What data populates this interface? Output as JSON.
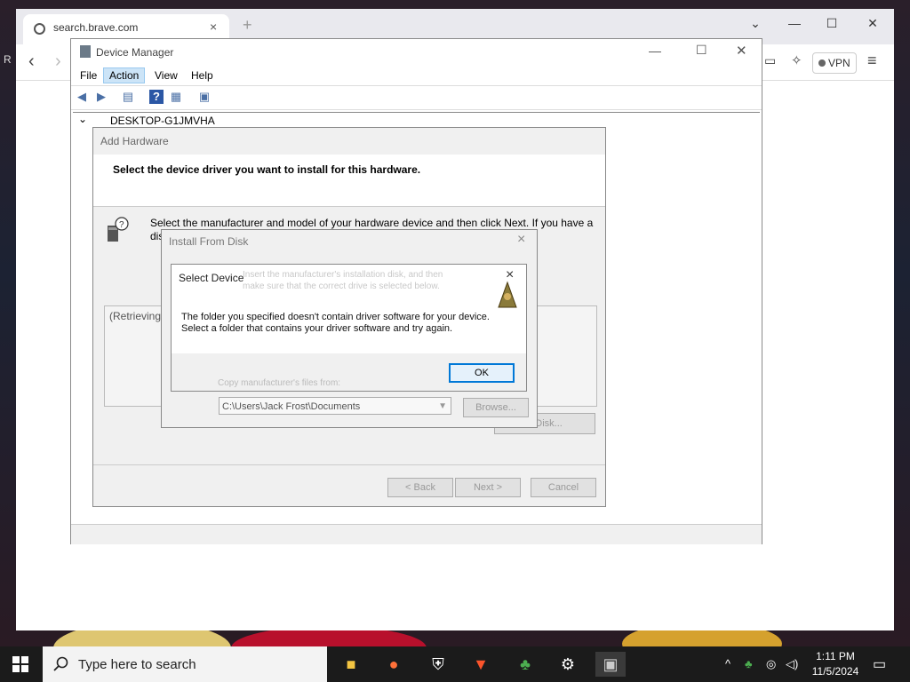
{
  "browser": {
    "tab_title": "search.brave.com",
    "tab_close": "×",
    "new_tab": "+",
    "vpn_label": "VPN"
  },
  "device_manager": {
    "title": "Device Manager",
    "menu": [
      "File",
      "Action",
      "View",
      "Help"
    ],
    "tree_root": "DESKTOP-G1JMVHA"
  },
  "add_hardware": {
    "title": "Add Hardware",
    "heading": "Select the device driver you want to install for this hardware.",
    "instruction": "Select the manufacturer and model of your hardware device and then click Next. If you have a disk that contains the driver you want to install, click Have Disk.",
    "retrieving": "(Retrieving",
    "have_disk": "e Disk...",
    "back": "< Back",
    "next": "Next >",
    "cancel": "Cancel"
  },
  "install_from_disk": {
    "title": "Install From Disk",
    "close": "×",
    "copy_label": "Copy manufacturer's files from:",
    "path": "C:\\Users\\Jack Frost\\Documents",
    "browse": "Browse..."
  },
  "select_device": {
    "title": "Select Device",
    "close": "×",
    "ghost_line1": "Insert the manufacturer's installation disk, and then",
    "ghost_line2": "make sure that the correct drive is selected below.",
    "message": "The folder you specified doesn't contain driver software for your device. Select a folder that contains your driver software and try again.",
    "ok": "OK"
  },
  "taskbar": {
    "search_placeholder": "Type here to search",
    "time": "1:11 PM",
    "date": "11/5/2024",
    "apps": [
      "file-explorer-icon",
      "firefox-icon",
      "shield-icon",
      "brave-icon",
      "users-icon",
      "gear-icon",
      "device-manager-icon"
    ]
  },
  "colors": {
    "accent": "#0078d7",
    "selection": "#cce4f7",
    "taskbar": "#1b1b1b"
  }
}
